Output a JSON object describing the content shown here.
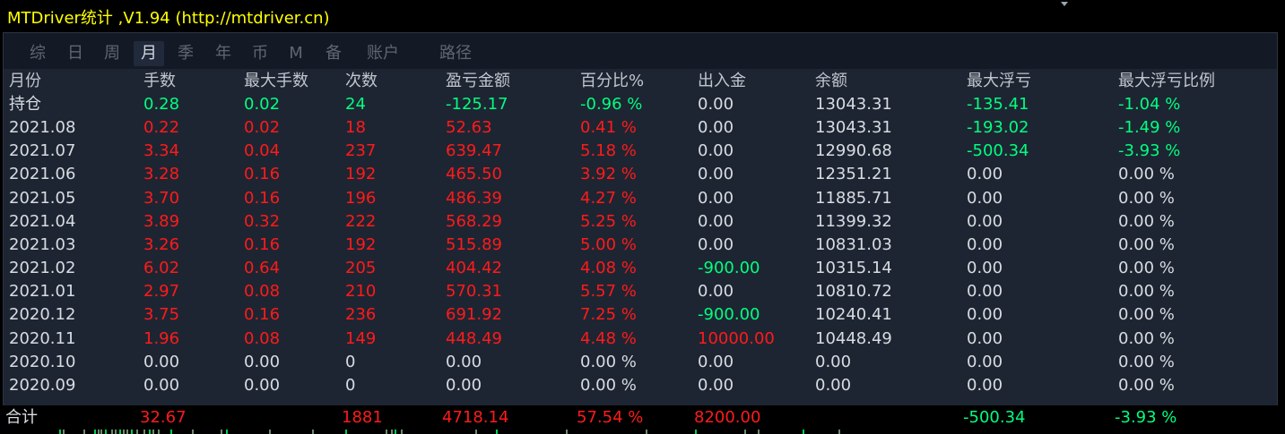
{
  "window": {
    "title": "MTDriver统计 ,V1.94 (http://mtdriver.cn)"
  },
  "tabs": [
    {
      "label": "综",
      "active": false
    },
    {
      "label": "日",
      "active": false
    },
    {
      "label": "周",
      "active": false
    },
    {
      "label": "月",
      "active": true
    },
    {
      "label": "季",
      "active": false
    },
    {
      "label": "年",
      "active": false
    },
    {
      "label": "币",
      "active": false
    },
    {
      "label": "M",
      "active": false
    },
    {
      "label": "备",
      "active": false
    },
    {
      "label": "账户",
      "active": false
    },
    {
      "label": "路径",
      "active": false
    }
  ],
  "table": {
    "headers": [
      "月份",
      "手数",
      "最大手数",
      "次数",
      "盈亏金额",
      "百分比%",
      "出入金",
      "余额",
      "最大浮亏",
      "最大浮亏比例"
    ],
    "rows": [
      {
        "cells": [
          "持仓",
          "0.28",
          "0.02",
          "24",
          "-125.17",
          "-0.96 %",
          "0.00",
          "13043.31",
          "-135.41",
          "-1.04 %"
        ],
        "colors": [
          "white",
          "green",
          "green",
          "green",
          "green",
          "green",
          "white",
          "white",
          "green",
          "green"
        ]
      },
      {
        "cells": [
          "2021.08",
          "0.22",
          "0.02",
          "18",
          "52.63",
          "0.41 %",
          "0.00",
          "13043.31",
          "-193.02",
          "-1.49 %"
        ],
        "colors": [
          "white",
          "red",
          "red",
          "red",
          "red",
          "red",
          "white",
          "white",
          "green",
          "green"
        ]
      },
      {
        "cells": [
          "2021.07",
          "3.34",
          "0.04",
          "237",
          "639.47",
          "5.18 %",
          "0.00",
          "12990.68",
          "-500.34",
          "-3.93 %"
        ],
        "colors": [
          "white",
          "red",
          "red",
          "red",
          "red",
          "red",
          "white",
          "white",
          "green",
          "green"
        ]
      },
      {
        "cells": [
          "2021.06",
          "3.28",
          "0.16",
          "192",
          "465.50",
          "3.92 %",
          "0.00",
          "12351.21",
          "0.00",
          "0.00 %"
        ],
        "colors": [
          "white",
          "red",
          "red",
          "red",
          "red",
          "red",
          "white",
          "white",
          "white",
          "white"
        ]
      },
      {
        "cells": [
          "2021.05",
          "3.70",
          "0.16",
          "196",
          "486.39",
          "4.27 %",
          "0.00",
          "11885.71",
          "0.00",
          "0.00 %"
        ],
        "colors": [
          "white",
          "red",
          "red",
          "red",
          "red",
          "red",
          "white",
          "white",
          "white",
          "white"
        ]
      },
      {
        "cells": [
          "2021.04",
          "3.89",
          "0.32",
          "222",
          "568.29",
          "5.25 %",
          "0.00",
          "11399.32",
          "0.00",
          "0.00 %"
        ],
        "colors": [
          "white",
          "red",
          "red",
          "red",
          "red",
          "red",
          "white",
          "white",
          "white",
          "white"
        ]
      },
      {
        "cells": [
          "2021.03",
          "3.26",
          "0.16",
          "192",
          "515.89",
          "5.00 %",
          "0.00",
          "10831.03",
          "0.00",
          "0.00 %"
        ],
        "colors": [
          "white",
          "red",
          "red",
          "red",
          "red",
          "red",
          "white",
          "white",
          "white",
          "white"
        ]
      },
      {
        "cells": [
          "2021.02",
          "6.02",
          "0.64",
          "205",
          "404.42",
          "4.08 %",
          "-900.00",
          "10315.14",
          "0.00",
          "0.00 %"
        ],
        "colors": [
          "white",
          "red",
          "red",
          "red",
          "red",
          "red",
          "green",
          "white",
          "white",
          "white"
        ]
      },
      {
        "cells": [
          "2021.01",
          "2.97",
          "0.08",
          "210",
          "570.31",
          "5.57 %",
          "0.00",
          "10810.72",
          "0.00",
          "0.00 %"
        ],
        "colors": [
          "white",
          "red",
          "red",
          "red",
          "red",
          "red",
          "white",
          "white",
          "white",
          "white"
        ]
      },
      {
        "cells": [
          "2020.12",
          "3.75",
          "0.16",
          "236",
          "691.92",
          "7.25 %",
          "-900.00",
          "10240.41",
          "0.00",
          "0.00 %"
        ],
        "colors": [
          "white",
          "red",
          "red",
          "red",
          "red",
          "red",
          "green",
          "white",
          "white",
          "white"
        ]
      },
      {
        "cells": [
          "2020.11",
          "1.96",
          "0.08",
          "149",
          "448.49",
          "4.48 %",
          "10000.00",
          "10448.49",
          "0.00",
          "0.00 %"
        ],
        "colors": [
          "white",
          "red",
          "red",
          "red",
          "red",
          "red",
          "red",
          "white",
          "white",
          "white"
        ]
      },
      {
        "cells": [
          "2020.10",
          "0.00",
          "0.00",
          "0",
          "0.00",
          "0.00 %",
          "0.00",
          "0.00",
          "0.00",
          "0.00 %"
        ],
        "colors": [
          "white",
          "white",
          "white",
          "white",
          "white",
          "white",
          "white",
          "white",
          "white",
          "white"
        ]
      },
      {
        "cells": [
          "2020.09",
          "0.00",
          "0.00",
          "0",
          "0.00",
          "0.00 %",
          "0.00",
          "0.00",
          "0.00",
          "0.00 %"
        ],
        "colors": [
          "white",
          "white",
          "white",
          "white",
          "white",
          "white",
          "white",
          "white",
          "white",
          "white"
        ]
      }
    ],
    "total": {
      "cells": [
        "合计",
        "32.67",
        "",
        "1881",
        "4718.14",
        "57.54 %",
        "8200.00",
        "",
        "-500.34",
        "-3.93 %"
      ],
      "colors": [
        "white",
        "red",
        "red",
        "red",
        "red",
        "red",
        "red",
        "white",
        "green",
        "green"
      ]
    }
  },
  "colors": {
    "green": "#00ff7f",
    "red": "#ff1a1a",
    "text": "#d8dce2",
    "title": "#ffff00"
  }
}
